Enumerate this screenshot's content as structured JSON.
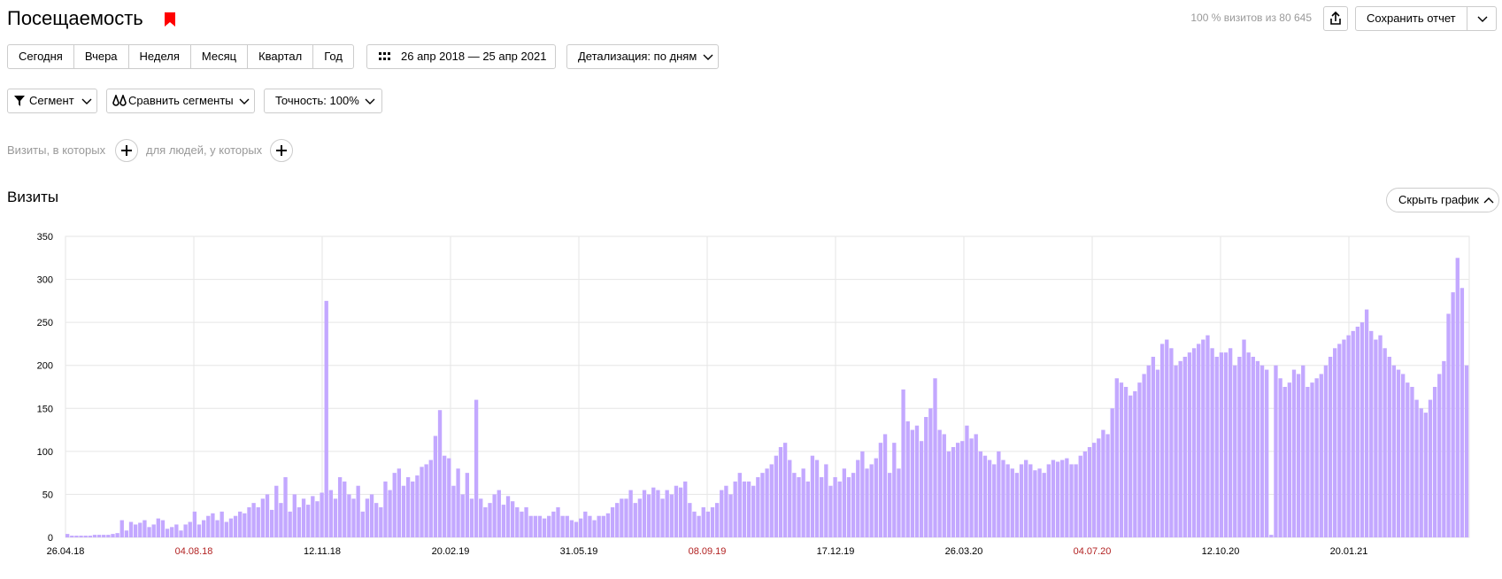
{
  "header": {
    "title": "Посещаемость",
    "visits_info": "100 % визитов из 80 645",
    "save_label": "Сохранить отчет",
    "bookmark_color": "#ff0000"
  },
  "periods": [
    "Сегодня",
    "Вчера",
    "Неделя",
    "Месяц",
    "Квартал",
    "Год"
  ],
  "date_range": "26 апр 2018 — 25 апр 2021",
  "detail_label": "Детализация: по дням",
  "segment_label": "Сегмент",
  "compare_label": "Сравнить сегменты",
  "accuracy_label": "Точность: 100%",
  "filters": {
    "visits_text": "Визиты, в которых",
    "people_text": "для людей, у которых"
  },
  "section": {
    "title": "Визиты",
    "hide_label": "Скрыть график"
  },
  "chart_data": {
    "type": "bar",
    "title": "",
    "xlabel": "",
    "ylabel": "",
    "ylim": [
      0,
      350
    ],
    "yticks": [
      0,
      50,
      100,
      150,
      200,
      250,
      300,
      350
    ],
    "grid": true,
    "bar_color": "#c3a8ff",
    "tick_color_normal": "#000000",
    "tick_color_highlight": "#b22222",
    "x_ticks": [
      {
        "label": "26.04.18",
        "highlight": false
      },
      {
        "label": "04.08.18",
        "highlight": true
      },
      {
        "label": "12.11.18",
        "highlight": false
      },
      {
        "label": "20.02.19",
        "highlight": false
      },
      {
        "label": "31.05.19",
        "highlight": false
      },
      {
        "label": "08.09.19",
        "highlight": true
      },
      {
        "label": "17.12.19",
        "highlight": false
      },
      {
        "label": "26.03.20",
        "highlight": false
      },
      {
        "label": "04.07.20",
        "highlight": true
      },
      {
        "label": "12.10.20",
        "highlight": false
      },
      {
        "label": "20.01.21",
        "highlight": false
      }
    ],
    "series": [
      {
        "values": [
          4,
          2,
          2,
          2,
          2,
          2,
          3,
          3,
          3,
          3,
          4,
          5,
          20,
          8,
          18,
          15,
          17,
          20,
          12,
          15,
          22,
          20,
          10,
          12,
          15,
          8,
          15,
          18,
          30,
          15,
          20,
          25,
          28,
          20,
          30,
          18,
          22,
          25,
          30,
          28,
          35,
          40,
          35,
          45,
          50,
          32,
          60,
          40,
          70,
          30,
          50,
          35,
          45,
          38,
          48,
          42,
          52,
          275,
          55,
          45,
          70,
          65,
          50,
          45,
          60,
          30,
          45,
          50,
          40,
          35,
          65,
          55,
          75,
          80,
          60,
          70,
          65,
          72,
          82,
          85,
          90,
          118,
          148,
          95,
          92,
          60,
          80,
          50,
          75,
          45,
          160,
          45,
          35,
          40,
          50,
          55,
          38,
          48,
          42,
          35,
          30,
          35,
          25,
          25,
          25,
          22,
          25,
          30,
          35,
          25,
          25,
          20,
          18,
          22,
          30,
          25,
          20,
          25,
          25,
          28,
          35,
          40,
          45,
          45,
          55,
          40,
          45,
          55,
          50,
          58,
          55,
          45,
          55,
          50,
          60,
          58,
          65,
          40,
          30,
          25,
          35,
          30,
          35,
          40,
          55,
          60,
          50,
          65,
          75,
          65,
          65,
          60,
          70,
          75,
          80,
          85,
          95,
          105,
          110,
          90,
          75,
          70,
          80,
          65,
          95,
          90,
          70,
          85,
          60,
          70,
          65,
          80,
          70,
          75,
          90,
          100,
          80,
          85,
          92,
          110,
          120,
          75,
          110,
          80,
          172,
          135,
          125,
          130,
          112,
          140,
          150,
          185,
          125,
          120,
          100,
          105,
          110,
          112,
          130,
          115,
          120,
          100,
          95,
          90,
          85,
          100,
          90,
          85,
          80,
          75,
          85,
          90,
          85,
          78,
          80,
          75,
          85,
          90,
          88,
          90,
          92,
          85,
          85,
          95,
          100,
          105,
          110,
          115,
          125,
          120,
          150,
          185,
          180,
          175,
          165,
          170,
          180,
          190,
          200,
          210,
          195,
          225,
          230,
          220,
          200,
          205,
          210,
          215,
          220,
          225,
          230,
          235,
          220,
          210,
          215,
          215,
          220,
          200,
          210,
          230,
          215,
          210,
          205,
          200,
          195,
          3,
          200,
          185,
          175,
          180,
          195,
          190,
          200,
          175,
          180,
          185,
          190,
          200,
          210,
          220,
          225,
          230,
          235,
          240,
          245,
          250,
          265,
          240,
          230,
          235,
          220,
          210,
          200,
          195,
          190,
          180,
          175,
          160,
          150,
          145,
          160,
          175,
          190,
          205,
          260,
          285,
          325,
          290,
          200
        ]
      }
    ]
  }
}
